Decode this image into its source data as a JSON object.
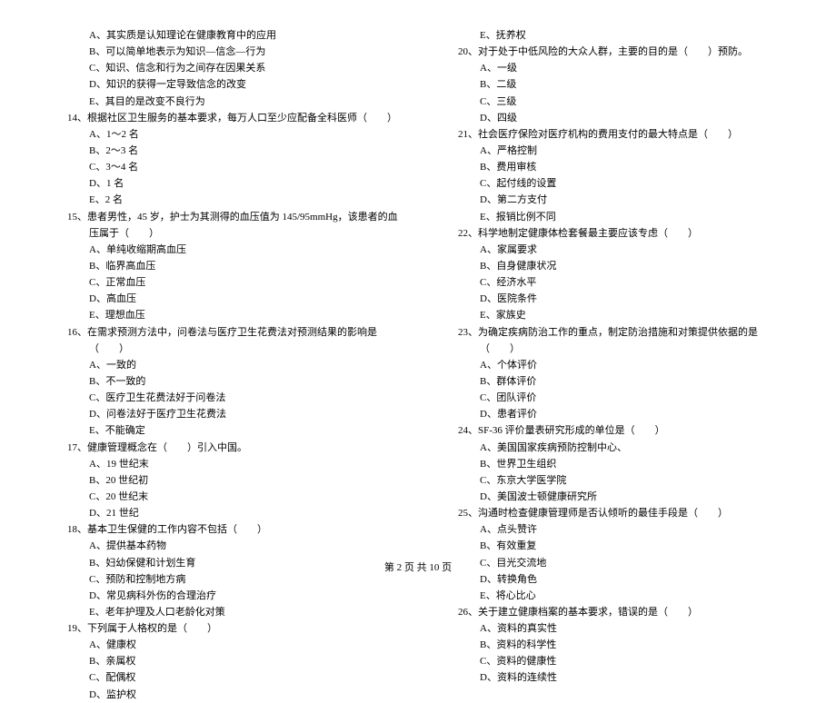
{
  "left_column": {
    "pre_options": [
      "A、其实质是认知理论在健康教育中的应用",
      "B、可以简单地表示为知识—信念—行为",
      "C、知识、信念和行为之间存在因果关系",
      "D、知识的获得一定导致信念的改变",
      "E、其目的是改变不良行为"
    ],
    "questions": [
      {
        "num": "14、",
        "text": "根据社区卫生服务的基本要求，每万人口至少应配备全科医师（　　）",
        "options": [
          "A、1～2 名",
          "B、2～3 名",
          "C、3～4 名",
          "D、1 名",
          "E、2 名"
        ]
      },
      {
        "num": "15、",
        "text": "患者男性，45 岁，护士为其测得的血压值为 145/95mmHg，该患者的血压属于（　　）",
        "options": [
          "A、单纯收缩期高血压",
          "B、临界高血压",
          "C、正常血压",
          "D、高血压",
          "E、理想血压"
        ]
      },
      {
        "num": "16、",
        "text": "在需求预测方法中，问卷法与医疗卫生花费法对预测结果的影响是（　　）",
        "options": [
          "A、一致的",
          "B、不一致的",
          "C、医疗卫生花费法好于问卷法",
          "D、问卷法好于医疗卫生花费法",
          "E、不能确定"
        ]
      },
      {
        "num": "17、",
        "text": "健康管理概念在（　　）引入中国。",
        "options": [
          "A、19 世纪末",
          "B、20 世纪初",
          "C、20 世纪末",
          "D、21 世纪"
        ]
      },
      {
        "num": "18、",
        "text": "基本卫生保健的工作内容不包括（　　）",
        "options": [
          "A、提供基本药物",
          "B、妇幼保健和计划生育",
          "C、预防和控制地方病",
          "D、常见病科外伤的合理治疗",
          "E、老年护理及人口老龄化对策"
        ]
      },
      {
        "num": "19、",
        "text": "下列属于人格权的是（　　）",
        "options": [
          "A、健康权",
          "B、亲属权",
          "C、配偶权",
          "D、监护权"
        ]
      }
    ]
  },
  "right_column": {
    "pre_options": [
      "E、抚养权"
    ],
    "questions": [
      {
        "num": "20、",
        "text": "对于处于中低风险的大众人群，主要的目的是（　　）预防。",
        "options": [
          "A、一级",
          "B、二级",
          "C、三级",
          "D、四级"
        ]
      },
      {
        "num": "21、",
        "text": "社会医疗保险对医疗机构的费用支付的最大特点是（　　）",
        "options": [
          "A、严格控制",
          "B、费用审核",
          "C、起付线的设置",
          "D、第二方支付",
          "E、报销比例不同"
        ]
      },
      {
        "num": "22、",
        "text": "科学地制定健康体检套餐最主要应该专虑（　　）",
        "options": [
          "A、家属要求",
          "B、自身健康状况",
          "C、经济水平",
          "D、医院条件",
          "E、家族史"
        ]
      },
      {
        "num": "23、",
        "text": "为确定疾病防治工作的重点，制定防治措施和对策提供依据的是（　　）",
        "options": [
          "A、个体评价",
          "B、群体评价",
          "C、团队评价",
          "D、患者评价"
        ]
      },
      {
        "num": "24、",
        "text": "SF-36 评价量表研究形成的单位是（　　）",
        "options": [
          "A、美国国家疾病预防控制中心、",
          "B、世界卫生组织",
          "C、东京大学医学院",
          "D、美国波士顿健康研究所"
        ]
      },
      {
        "num": "25、",
        "text": "沟通时检查健康管理师是否认倾听的最佳手段是（　　）",
        "options": [
          "A、点头赞许",
          "B、有效重复",
          "C、目光交流地",
          "D、转换角色",
          "E、将心比心"
        ]
      },
      {
        "num": "26、",
        "text": "关于建立健康档案的基本要求，错误的是（　　）",
        "options": [
          "A、资料的真实性",
          "B、资料的科学性",
          "C、资料的健康性",
          "D、资料的连续性"
        ]
      }
    ]
  },
  "footer": "第 2 页 共 10 页"
}
